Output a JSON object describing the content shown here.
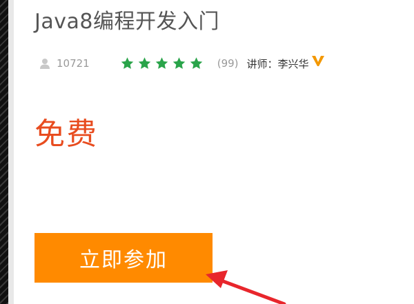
{
  "course": {
    "title": "Java8编程开发入门",
    "students": "10721",
    "rating_stars": 5,
    "reviews": "(99)",
    "teacher_label": "讲师：",
    "teacher_name": "李兴华",
    "price": "免费",
    "join_label": "立即参加"
  },
  "icons": {
    "user": "user-icon",
    "star": "star-icon",
    "verified": "verified-v-icon"
  },
  "colors": {
    "star_green": "#2aa44a",
    "price_red": "#e84c1f",
    "button_orange": "#ff8a00",
    "verified_orange": "#f39800",
    "annotation_arrow": "#e8262c"
  }
}
